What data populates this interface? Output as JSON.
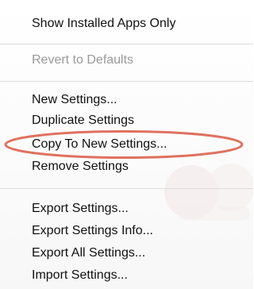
{
  "menu": {
    "groups": [
      {
        "items": [
          {
            "label": "Show Installed Apps Only",
            "enabled": true
          }
        ]
      },
      {
        "items": [
          {
            "label": "Revert to Defaults",
            "enabled": false
          }
        ]
      },
      {
        "items": [
          {
            "label": "New Settings...",
            "enabled": true
          },
          {
            "label": "Duplicate Settings",
            "enabled": true
          },
          {
            "label": "Copy To New Settings...",
            "enabled": true
          },
          {
            "label": "Remove Settings",
            "enabled": true
          }
        ]
      },
      {
        "items": [
          {
            "label": "Export Settings...",
            "enabled": true
          },
          {
            "label": "Export Settings Info...",
            "enabled": true
          },
          {
            "label": "Export All Settings...",
            "enabled": true
          },
          {
            "label": "Import Settings...",
            "enabled": true
          }
        ]
      }
    ]
  },
  "colors": {
    "text": "#111111",
    "disabled_text": "#9a9a9a",
    "separator": "#dcdcdc",
    "highlight_ellipse": "#e0715f"
  }
}
